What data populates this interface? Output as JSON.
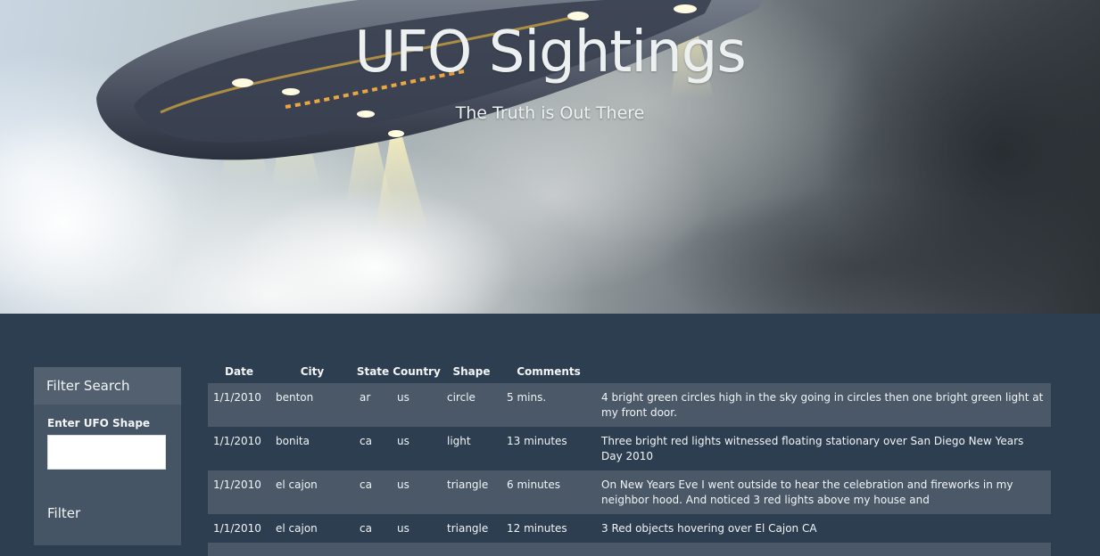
{
  "hero": {
    "title": "UFO Sightings",
    "subtitle": "The Truth is Out There"
  },
  "filter": {
    "header": "Filter Search",
    "label": "Enter UFO Shape",
    "input_value": "",
    "input_placeholder": "",
    "button_label": "Filter"
  },
  "table": {
    "columns": [
      "Date",
      "City",
      "State",
      "Country",
      "Shape",
      "Comments"
    ],
    "rows": [
      {
        "date": "1/1/2010",
        "city": "benton",
        "state": "ar",
        "country": "us",
        "shape": "circle",
        "duration": "5 mins.",
        "comments": "4 bright green circles high in the sky going in circles then one bright green light at my front door."
      },
      {
        "date": "1/1/2010",
        "city": "bonita",
        "state": "ca",
        "country": "us",
        "shape": "light",
        "duration": "13 minutes",
        "comments": "Three bright red lights witnessed floating stationary over San Diego New Years Day 2010"
      },
      {
        "date": "1/1/2010",
        "city": "el cajon",
        "state": "ca",
        "country": "us",
        "shape": "triangle",
        "duration": "6 minutes",
        "comments": "On New Years Eve I went outside to hear the celebration and fireworks in my neighbor hood. And noticed 3 red lights above my house and"
      },
      {
        "date": "1/1/2010",
        "city": "el cajon",
        "state": "ca",
        "country": "us",
        "shape": "triangle",
        "duration": "12 minutes",
        "comments": "3 Red objects hovering over El Cajon CA"
      }
    ]
  },
  "colors": {
    "background": "#2c3e50",
    "panel": "#465565",
    "row_stripe": "#4a5868",
    "text": "#ecf0f1"
  }
}
